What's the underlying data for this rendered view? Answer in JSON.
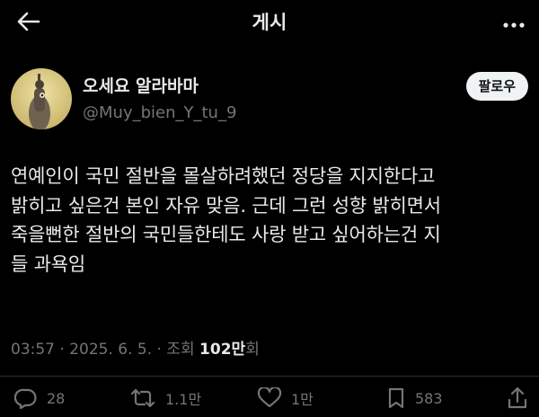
{
  "header": {
    "title": "게시",
    "back_icon": "arrow-left-icon",
    "more_icon": "more-horizontal-icon"
  },
  "author": {
    "display_name": "오세요 알라바마",
    "handle": "@Muy_bien_Y_tu_9",
    "follow_label": "팔로우"
  },
  "post": {
    "lines": [
      "연예인이 국민 절반을 몰살하려했던 정당을 지지한다고",
      "밝히고 싶은건 본인 자유 맞음. 근데 그런 성향 밝히면서",
      "죽을뻔한 절반의 국민들한테도 사랑 받고 싶어하는건 지",
      "들 과욕임"
    ]
  },
  "meta": {
    "time": "03:57",
    "sep1": " · ",
    "date": "2025. 6. 5.",
    "sep2": " · ",
    "views_label": "조회 ",
    "views_count": "102만",
    "views_suffix": "회"
  },
  "actions": {
    "reply_count": "28",
    "repost_count": "1.1만",
    "like_count": "1만",
    "bookmark_count": "583"
  },
  "colors": {
    "background": "#000000",
    "text": "#e7e9ea",
    "muted": "#71767b",
    "divider": "#2f3336",
    "follow_bg": "#eff3f4"
  }
}
